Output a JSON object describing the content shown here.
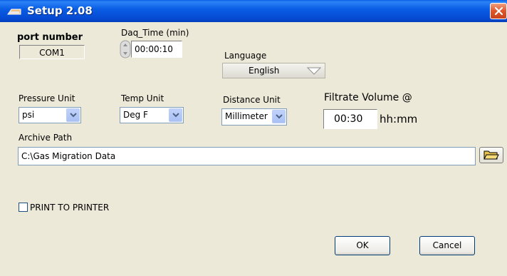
{
  "window": {
    "title": "Setup  2.08"
  },
  "port": {
    "label": "port number",
    "value": "COM1"
  },
  "daq": {
    "label": "Daq_Time (min)",
    "value": "00:00:10"
  },
  "language": {
    "label": "Language",
    "value": "English"
  },
  "pressure": {
    "label": "Pressure Unit",
    "value": "psi"
  },
  "temp": {
    "label": "Temp Unit",
    "value": "Deg F"
  },
  "distance": {
    "label": "Distance Unit",
    "value": "Millimeter"
  },
  "filtrate": {
    "label": "Filtrate Volume @",
    "value": "00:30",
    "unit": "hh:mm"
  },
  "archive": {
    "label": "Archive Path",
    "value": "C:\\Gas Migration Data"
  },
  "print": {
    "label": "PRINT TO PRINTER",
    "checked": false
  },
  "buttons": {
    "ok": "OK",
    "cancel": "Cancel"
  },
  "icons": {
    "title": "app-icon",
    "close": "close-icon",
    "spinner": "spinner-icon",
    "dropdown": "chevron-down-icon",
    "folder": "folder-icon"
  },
  "colors": {
    "titlebar": "#0a5ee5",
    "window_bg": "#ece9d8",
    "close": "#e0552a"
  }
}
